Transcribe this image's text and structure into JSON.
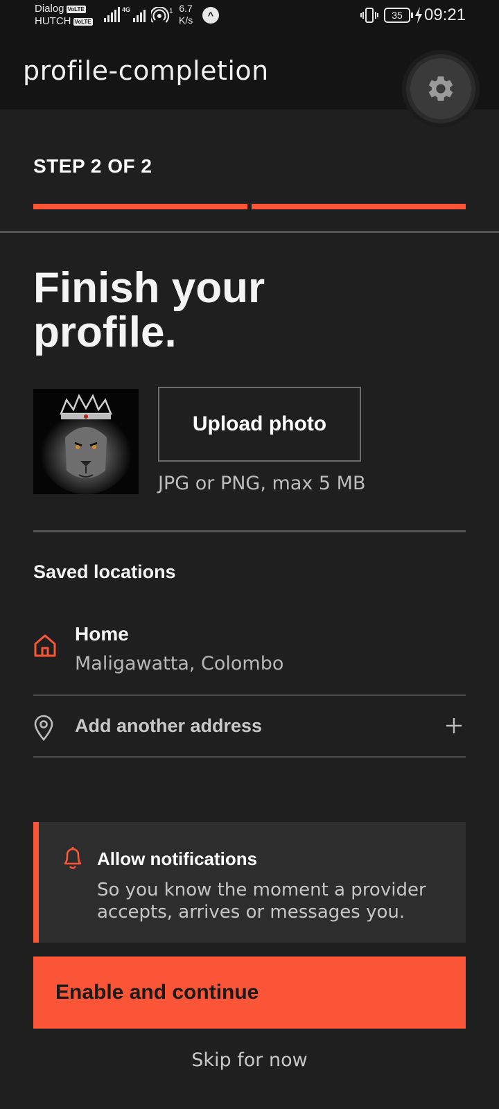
{
  "status_bar": {
    "carrier_1": "Dialog",
    "carrier_2": "HUTCH",
    "volte_badge": "VoLTE",
    "network_type": "4G",
    "hotspot_count": "1",
    "speed_value": "6.7",
    "speed_unit": "K/s",
    "battery": "35",
    "time": "09:21"
  },
  "app_bar": {
    "title": "profile-completion",
    "settings_icon": "gear-icon"
  },
  "step": {
    "label": "STEP 2 OF 2",
    "current": 2,
    "total": 2
  },
  "headline": {
    "line1": "Finish your",
    "line2": "profile."
  },
  "photo": {
    "avatar_alt": "lion-with-crown-image",
    "upload_label": "Upload photo",
    "hint": "JPG or PNG, max 5 MB"
  },
  "locations": {
    "section_title": "Saved locations",
    "items": [
      {
        "name": "Home",
        "address": "Maligawatta, Colombo",
        "icon": "home-icon"
      }
    ],
    "add_label": "Add another address",
    "add_icon": "map-pin-icon"
  },
  "notifications": {
    "icon": "bell-icon",
    "title": "Allow notifications",
    "body": "So you know the moment a provider accepts, arrives or messages you."
  },
  "actions": {
    "primary": "Enable and continue",
    "skip": "Skip for now"
  },
  "colors": {
    "accent": "#fa5536",
    "background": "#201f1f",
    "app_bar": "#141414"
  }
}
